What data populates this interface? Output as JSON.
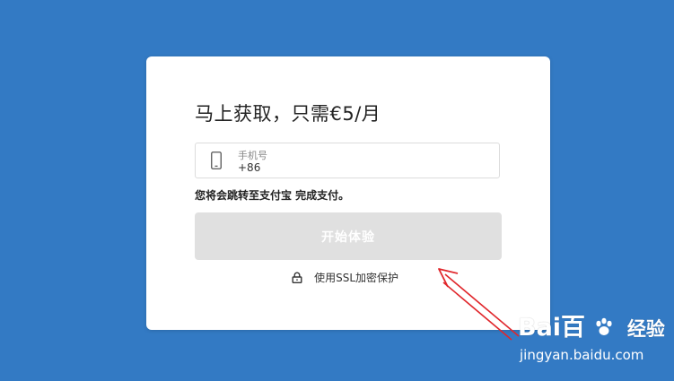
{
  "card": {
    "title": "马上获取，只需€5/月",
    "phone_field": {
      "label": "手机号",
      "value": "+86"
    },
    "redirect_note": "您将会跳转至支付宝 完成支付。",
    "start_button_label": "开始体验",
    "ssl_note": "使用SSL加密保护"
  },
  "watermark": {
    "brand": "Bai百",
    "brand_cn": "经验",
    "url": "jingyan.baidu.com"
  },
  "colors": {
    "background": "#337ac4",
    "card": "#ffffff",
    "button_disabled": "#e0e0e0",
    "annotation_arrow": "#e0262b"
  },
  "icons": {
    "phone": "phone-icon",
    "lock": "lock-icon"
  }
}
